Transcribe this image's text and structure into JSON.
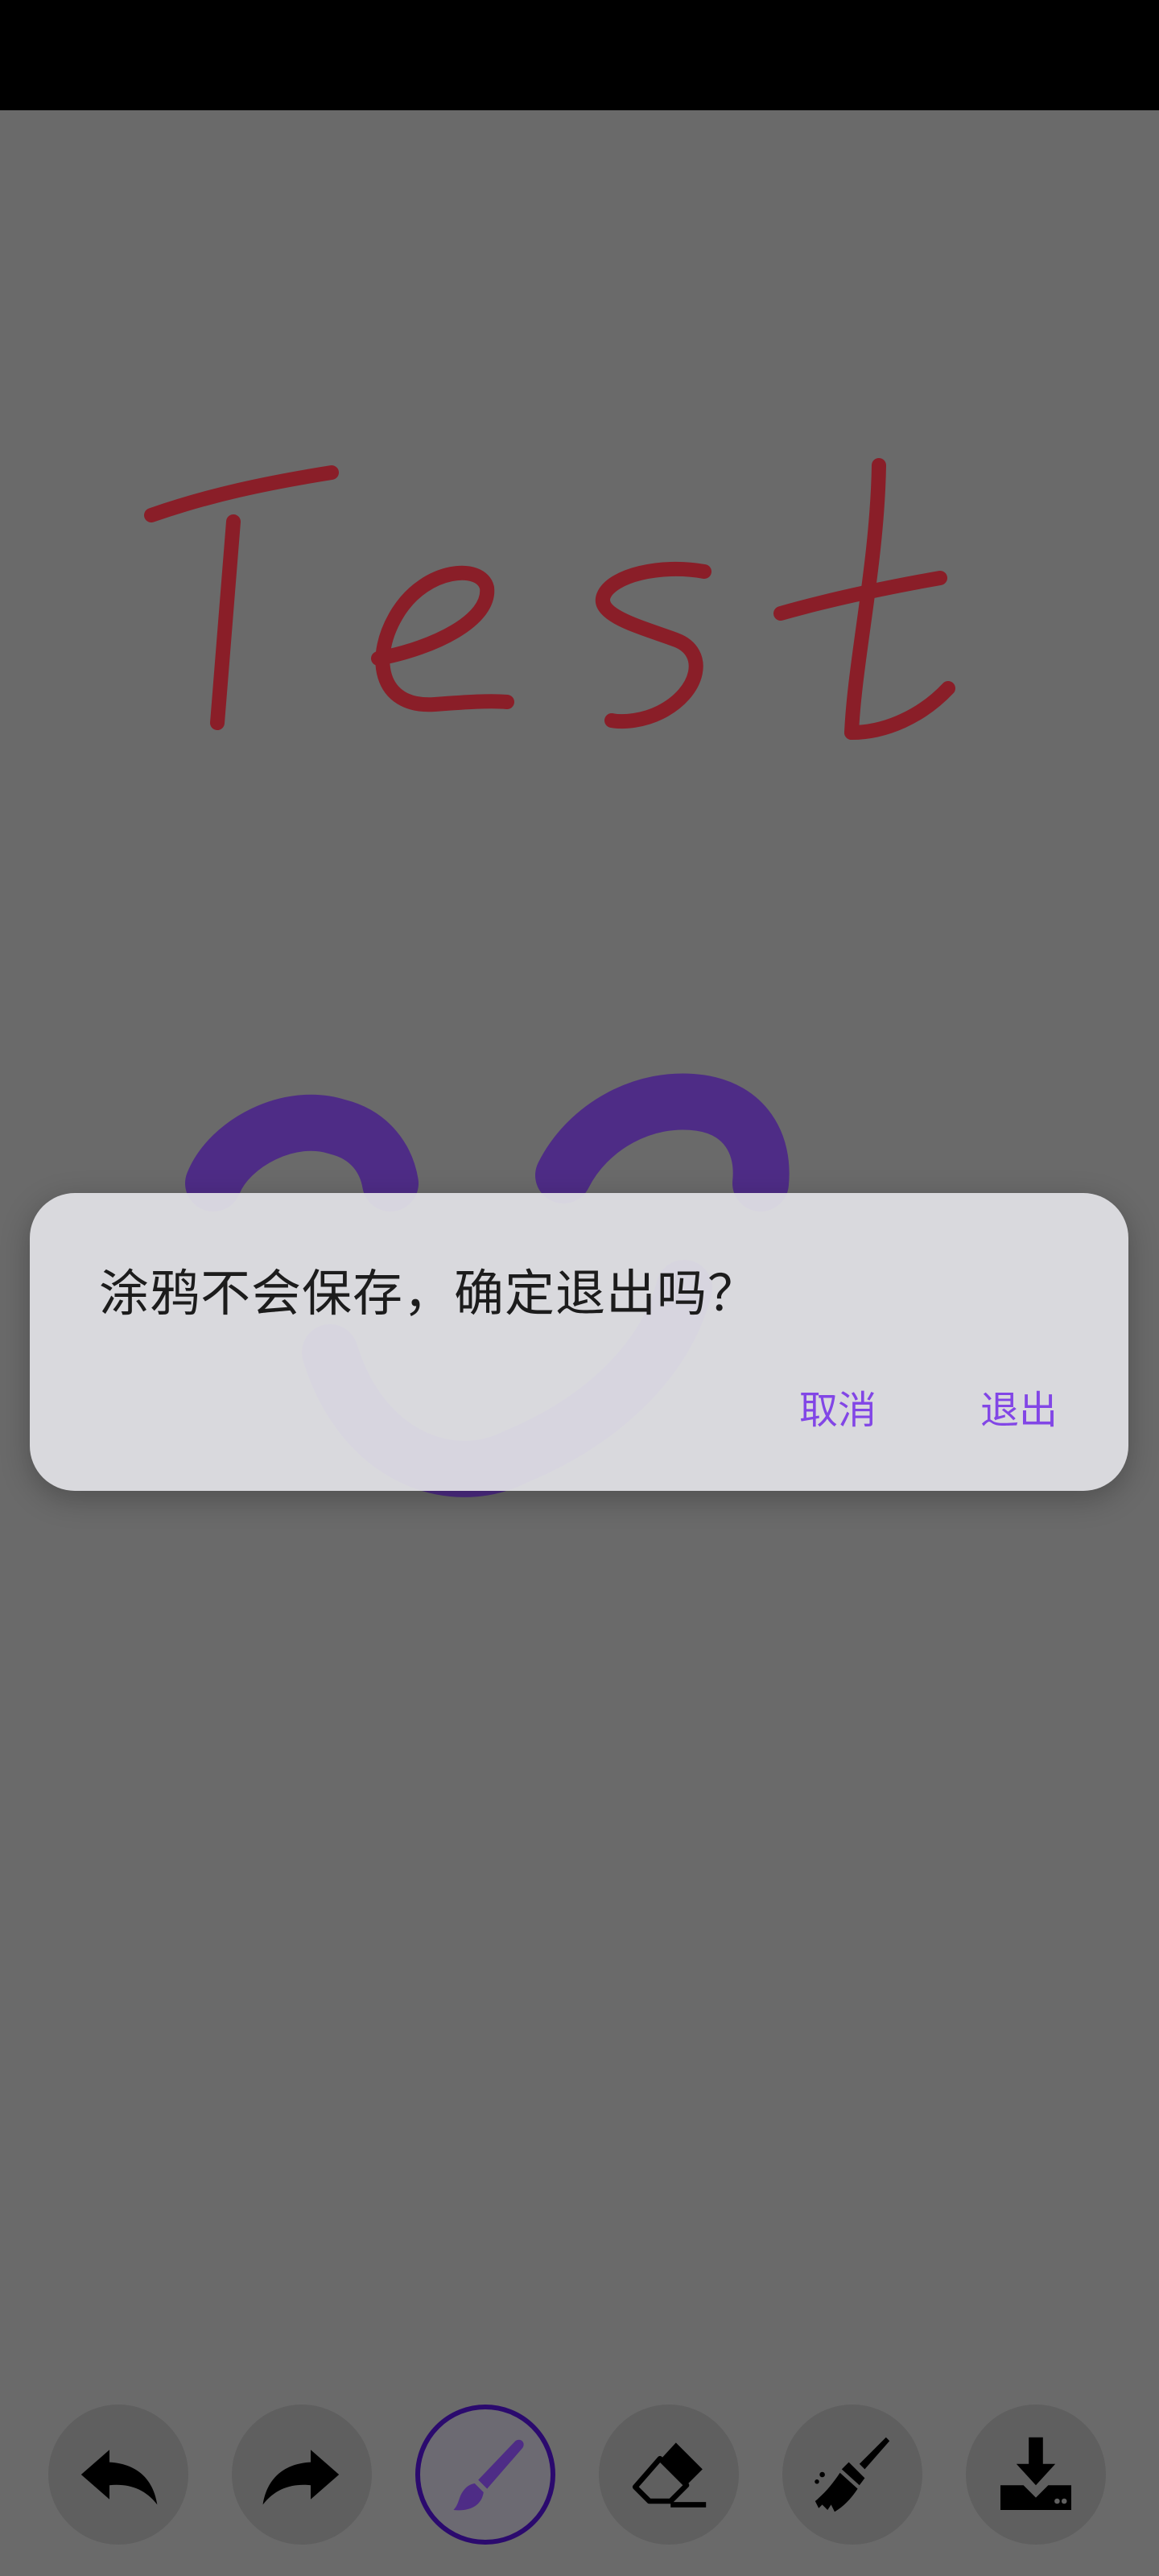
{
  "dialog": {
    "message": "涂鸦不会保存，确定退出吗？",
    "cancel_label": "取消",
    "exit_label": "退出"
  },
  "drawing": {
    "handwritten_text": "Test",
    "handwriting_color": "#8a1e28",
    "smile_color": "#4e2c86"
  },
  "toolbar": {
    "tools": [
      "undo-icon",
      "redo-icon",
      "brush-icon",
      "eraser-icon",
      "clear-broom-icon",
      "download-icon"
    ],
    "active_tool": "brush-icon"
  },
  "colors": {
    "accent": "#8246e6",
    "overlay": "#6a6a6a"
  }
}
